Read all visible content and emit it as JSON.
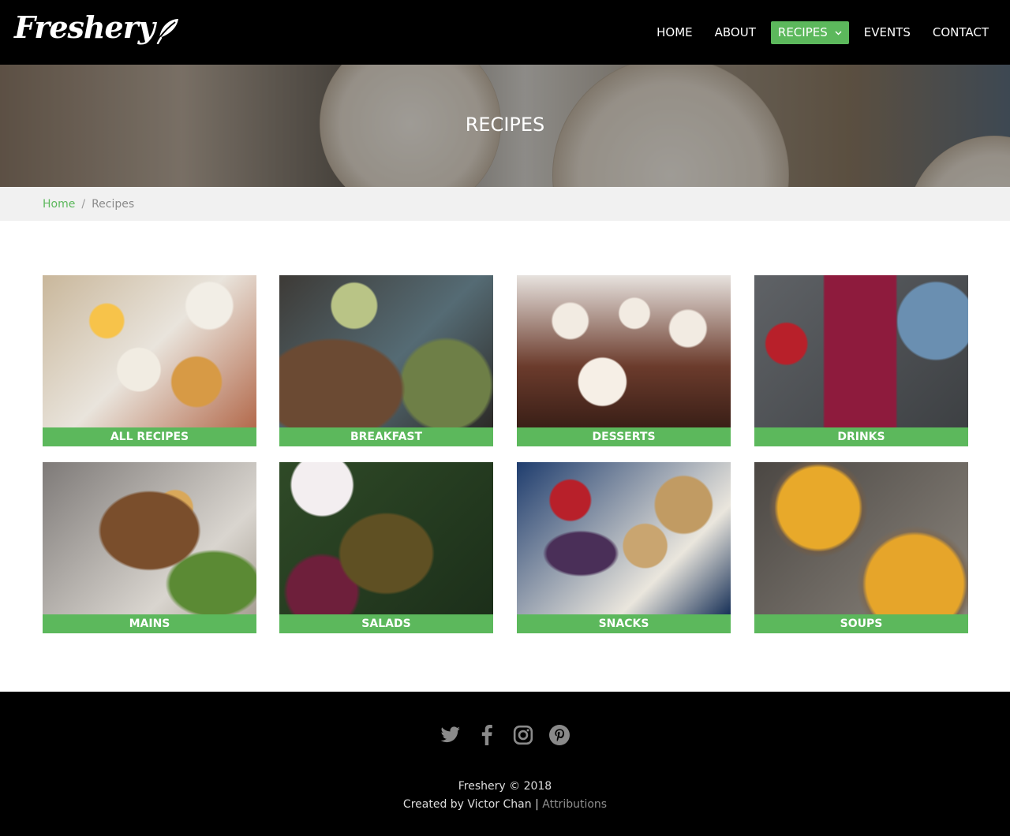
{
  "brand": {
    "logo_text": "Freshery"
  },
  "nav": {
    "items": [
      {
        "label": "HOME",
        "active": false
      },
      {
        "label": "ABOUT",
        "active": false
      },
      {
        "label": "RECIPES",
        "active": true
      },
      {
        "label": "EVENTS",
        "active": false
      },
      {
        "label": "CONTACT",
        "active": false
      }
    ]
  },
  "hero": {
    "title": "RECIPES"
  },
  "breadcrumb": {
    "home": "Home",
    "separator": "/",
    "current": "Recipes"
  },
  "categories": [
    {
      "label": "ALL RECIPES"
    },
    {
      "label": "BREAKFAST"
    },
    {
      "label": "DESSERTS"
    },
    {
      "label": "DRINKS"
    },
    {
      "label": "MAINS"
    },
    {
      "label": "SALADS"
    },
    {
      "label": "SNACKS"
    },
    {
      "label": "SOUPS"
    }
  ],
  "footer": {
    "social": [
      "twitter-icon",
      "facebook-icon",
      "instagram-icon",
      "pinterest-icon"
    ],
    "copyright": "Freshery © 2018",
    "created_by": "Created by Victor Chan",
    "divider": "|",
    "attributions": "Attributions"
  },
  "colors": {
    "accent": "#5cb85c",
    "nav_bg": "#000000",
    "breadcrumb_bg": "#f1f1f1",
    "footer_bg": "#000000",
    "social_icon": "#8a8a8a"
  }
}
